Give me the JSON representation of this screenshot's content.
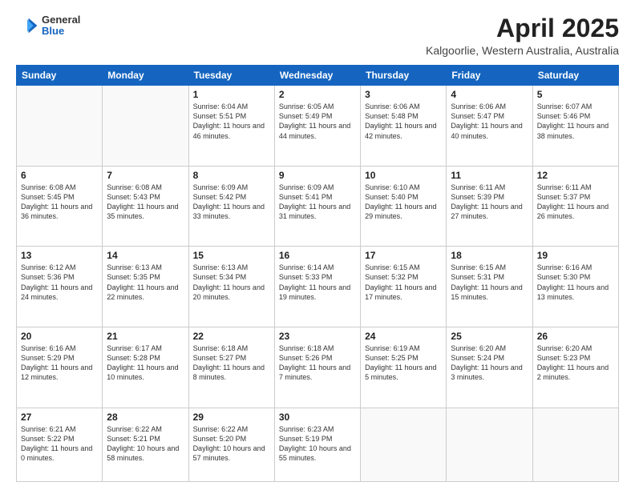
{
  "header": {
    "logo": {
      "general": "General",
      "blue": "Blue"
    },
    "title": "April 2025",
    "location": "Kalgoorlie, Western Australia, Australia"
  },
  "weekdays": [
    "Sunday",
    "Monday",
    "Tuesday",
    "Wednesday",
    "Thursday",
    "Friday",
    "Saturday"
  ],
  "weeks": [
    [
      {
        "day": "",
        "info": ""
      },
      {
        "day": "",
        "info": ""
      },
      {
        "day": "1",
        "info": "Sunrise: 6:04 AM\nSunset: 5:51 PM\nDaylight: 11 hours and 46 minutes."
      },
      {
        "day": "2",
        "info": "Sunrise: 6:05 AM\nSunset: 5:49 PM\nDaylight: 11 hours and 44 minutes."
      },
      {
        "day": "3",
        "info": "Sunrise: 6:06 AM\nSunset: 5:48 PM\nDaylight: 11 hours and 42 minutes."
      },
      {
        "day": "4",
        "info": "Sunrise: 6:06 AM\nSunset: 5:47 PM\nDaylight: 11 hours and 40 minutes."
      },
      {
        "day": "5",
        "info": "Sunrise: 6:07 AM\nSunset: 5:46 PM\nDaylight: 11 hours and 38 minutes."
      }
    ],
    [
      {
        "day": "6",
        "info": "Sunrise: 6:08 AM\nSunset: 5:45 PM\nDaylight: 11 hours and 36 minutes."
      },
      {
        "day": "7",
        "info": "Sunrise: 6:08 AM\nSunset: 5:43 PM\nDaylight: 11 hours and 35 minutes."
      },
      {
        "day": "8",
        "info": "Sunrise: 6:09 AM\nSunset: 5:42 PM\nDaylight: 11 hours and 33 minutes."
      },
      {
        "day": "9",
        "info": "Sunrise: 6:09 AM\nSunset: 5:41 PM\nDaylight: 11 hours and 31 minutes."
      },
      {
        "day": "10",
        "info": "Sunrise: 6:10 AM\nSunset: 5:40 PM\nDaylight: 11 hours and 29 minutes."
      },
      {
        "day": "11",
        "info": "Sunrise: 6:11 AM\nSunset: 5:39 PM\nDaylight: 11 hours and 27 minutes."
      },
      {
        "day": "12",
        "info": "Sunrise: 6:11 AM\nSunset: 5:37 PM\nDaylight: 11 hours and 26 minutes."
      }
    ],
    [
      {
        "day": "13",
        "info": "Sunrise: 6:12 AM\nSunset: 5:36 PM\nDaylight: 11 hours and 24 minutes."
      },
      {
        "day": "14",
        "info": "Sunrise: 6:13 AM\nSunset: 5:35 PM\nDaylight: 11 hours and 22 minutes."
      },
      {
        "day": "15",
        "info": "Sunrise: 6:13 AM\nSunset: 5:34 PM\nDaylight: 11 hours and 20 minutes."
      },
      {
        "day": "16",
        "info": "Sunrise: 6:14 AM\nSunset: 5:33 PM\nDaylight: 11 hours and 19 minutes."
      },
      {
        "day": "17",
        "info": "Sunrise: 6:15 AM\nSunset: 5:32 PM\nDaylight: 11 hours and 17 minutes."
      },
      {
        "day": "18",
        "info": "Sunrise: 6:15 AM\nSunset: 5:31 PM\nDaylight: 11 hours and 15 minutes."
      },
      {
        "day": "19",
        "info": "Sunrise: 6:16 AM\nSunset: 5:30 PM\nDaylight: 11 hours and 13 minutes."
      }
    ],
    [
      {
        "day": "20",
        "info": "Sunrise: 6:16 AM\nSunset: 5:29 PM\nDaylight: 11 hours and 12 minutes."
      },
      {
        "day": "21",
        "info": "Sunrise: 6:17 AM\nSunset: 5:28 PM\nDaylight: 11 hours and 10 minutes."
      },
      {
        "day": "22",
        "info": "Sunrise: 6:18 AM\nSunset: 5:27 PM\nDaylight: 11 hours and 8 minutes."
      },
      {
        "day": "23",
        "info": "Sunrise: 6:18 AM\nSunset: 5:26 PM\nDaylight: 11 hours and 7 minutes."
      },
      {
        "day": "24",
        "info": "Sunrise: 6:19 AM\nSunset: 5:25 PM\nDaylight: 11 hours and 5 minutes."
      },
      {
        "day": "25",
        "info": "Sunrise: 6:20 AM\nSunset: 5:24 PM\nDaylight: 11 hours and 3 minutes."
      },
      {
        "day": "26",
        "info": "Sunrise: 6:20 AM\nSunset: 5:23 PM\nDaylight: 11 hours and 2 minutes."
      }
    ],
    [
      {
        "day": "27",
        "info": "Sunrise: 6:21 AM\nSunset: 5:22 PM\nDaylight: 11 hours and 0 minutes."
      },
      {
        "day": "28",
        "info": "Sunrise: 6:22 AM\nSunset: 5:21 PM\nDaylight: 10 hours and 58 minutes."
      },
      {
        "day": "29",
        "info": "Sunrise: 6:22 AM\nSunset: 5:20 PM\nDaylight: 10 hours and 57 minutes."
      },
      {
        "day": "30",
        "info": "Sunrise: 6:23 AM\nSunset: 5:19 PM\nDaylight: 10 hours and 55 minutes."
      },
      {
        "day": "",
        "info": ""
      },
      {
        "day": "",
        "info": ""
      },
      {
        "day": "",
        "info": ""
      }
    ]
  ]
}
